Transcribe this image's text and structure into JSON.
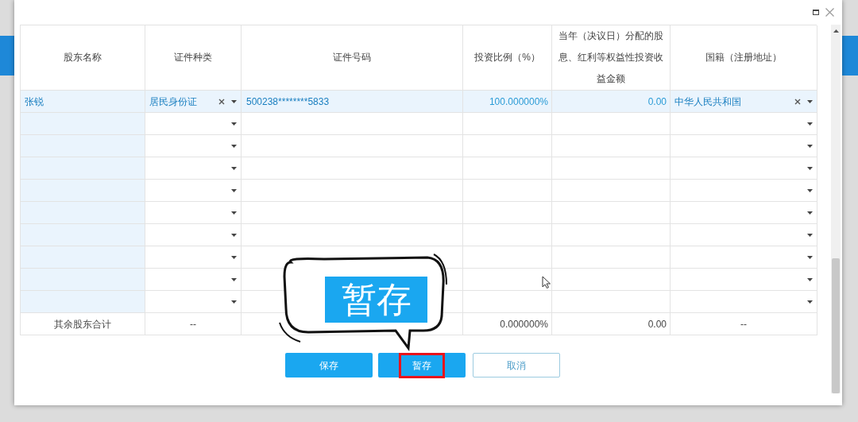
{
  "table": {
    "columns": [
      "股东名称",
      "证件种类",
      "证件号码",
      "投资比例（%）",
      "当年（决议日）分配的股息、红利等权益性投资收益金额",
      "国籍（注册地址）"
    ],
    "rows": [
      {
        "selected": true,
        "name": "张锐",
        "id_type": "居民身份证",
        "id_number": "500238********5833",
        "ratio": "100.000000%",
        "dividend": "0.00",
        "nationality": "中华人民共和国"
      },
      {
        "selected": false
      },
      {
        "selected": false
      },
      {
        "selected": false
      },
      {
        "selected": false
      },
      {
        "selected": false
      },
      {
        "selected": false
      },
      {
        "selected": false
      },
      {
        "selected": false
      },
      {
        "selected": false
      }
    ],
    "summary": {
      "label": "其余股东合计",
      "id_type": "--",
      "ratio": "0.000000%",
      "dividend": "0.00",
      "nationality": "--"
    }
  },
  "buttons": [
    {
      "label": "保存",
      "kind": "primary",
      "highlighted": false
    },
    {
      "label": "暂存",
      "kind": "primary",
      "highlighted": true
    },
    {
      "label": "取消",
      "kind": "secondary",
      "highlighted": false
    }
  ],
  "callout": {
    "text": "暂存"
  }
}
